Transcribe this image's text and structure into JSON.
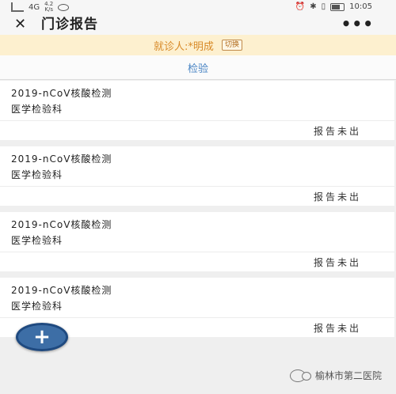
{
  "status_bar": {
    "network": "4G",
    "speed_value": "4.2",
    "speed_unit": "K/s",
    "time": "10:05"
  },
  "nav": {
    "title": "门诊报告",
    "close_glyph": "✕",
    "more_glyph": "•••"
  },
  "patient": {
    "text": "就诊人:*明成",
    "switch_label": "切换"
  },
  "tabs": {
    "active": "检验"
  },
  "reports": [
    {
      "title": "2019-nCoV核酸检测",
      "dept": "医学检验科",
      "status": "报告未出"
    },
    {
      "title": "2019-nCoV核酸检测",
      "dept": "医学检验科",
      "status": "报告未出"
    },
    {
      "title": "2019-nCoV核酸检测",
      "dept": "医学检验科",
      "status": "报告未出"
    },
    {
      "title": "2019-nCoV核酸检测",
      "dept": "医学检验科",
      "status": "报告未出"
    }
  ],
  "fab": {
    "glyph": "+"
  },
  "watermark": {
    "text": "榆林市第二医院"
  },
  "colors": {
    "accent": "#4a85c4",
    "patient_bar_bg": "#fdf0cf",
    "patient_text": "#d88a28",
    "fab": "#3d6ea6"
  }
}
